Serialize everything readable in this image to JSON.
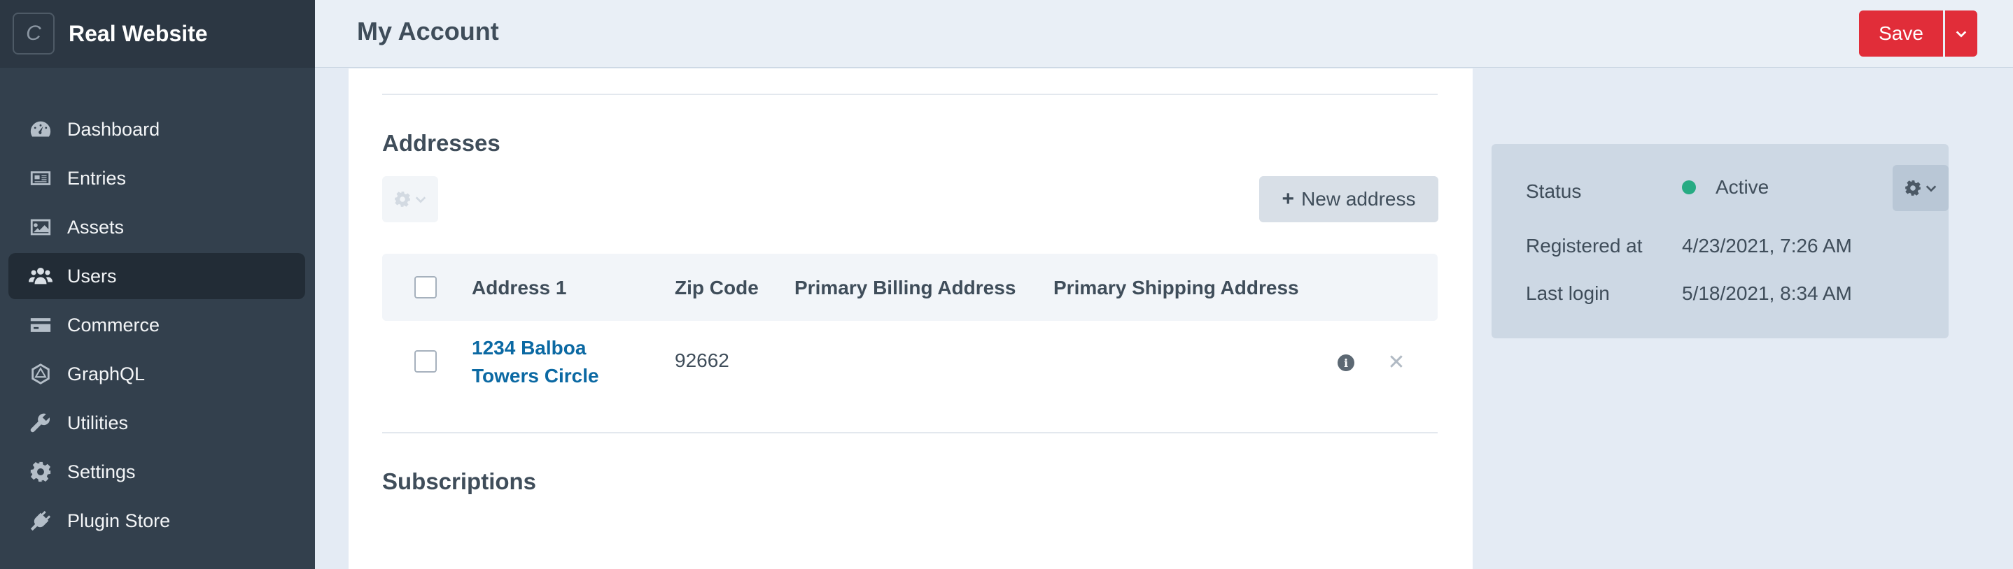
{
  "site": {
    "logo_letter": "C",
    "name": "Real Website"
  },
  "nav": {
    "items": [
      {
        "label": "Dashboard",
        "icon": "dashboard-icon"
      },
      {
        "label": "Entries",
        "icon": "entries-icon"
      },
      {
        "label": "Assets",
        "icon": "assets-icon"
      },
      {
        "label": "Users",
        "icon": "users-icon",
        "active": true
      },
      {
        "label": "Commerce",
        "icon": "commerce-icon"
      },
      {
        "label": "GraphQL",
        "icon": "graphql-icon"
      },
      {
        "label": "Utilities",
        "icon": "wrench-icon"
      },
      {
        "label": "Settings",
        "icon": "gear-icon"
      },
      {
        "label": "Plugin Store",
        "icon": "plug-icon"
      }
    ]
  },
  "header": {
    "title": "My Account",
    "save_label": "Save"
  },
  "addresses": {
    "title": "Addresses",
    "new_address_label": "New address",
    "columns": [
      "Address 1",
      "Zip Code",
      "Primary Billing Address",
      "Primary Shipping Address"
    ],
    "rows": [
      {
        "address1": "1234 Balboa Towers Circle",
        "zip": "92662",
        "primary_billing": "",
        "primary_shipping": ""
      }
    ]
  },
  "subscriptions": {
    "title": "Subscriptions"
  },
  "meta": {
    "status_label": "Status",
    "status_value": "Active",
    "status_color": "#27ab83",
    "registered_label": "Registered at",
    "registered_value": "4/23/2021, 7:26 AM",
    "last_login_label": "Last login",
    "last_login_value": "5/18/2021, 8:34 AM"
  },
  "colors": {
    "accent": "#e12d39",
    "link": "#0b69a3",
    "sidebar": "#33404d"
  }
}
